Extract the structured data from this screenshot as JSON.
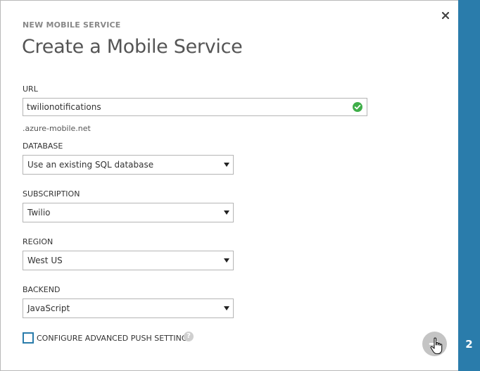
{
  "wizard": {
    "label": "NEW MOBILE SERVICE",
    "title": "Create a Mobile Service",
    "step": "2"
  },
  "url": {
    "label": "URL",
    "value": "twilionotifications",
    "suffix": ".azure-mobile.net",
    "status_icon": "check-circle-icon"
  },
  "database": {
    "label": "DATABASE",
    "selected": "Use an existing SQL database"
  },
  "subscription": {
    "label": "SUBSCRIPTION",
    "selected": "Twilio"
  },
  "region": {
    "label": "REGION",
    "selected": "West US"
  },
  "backend": {
    "label": "BACKEND",
    "selected": "JavaScript"
  },
  "advanced": {
    "label": "CONFIGURE ADVANCED PUSH SETTINGS",
    "checked": false,
    "help": "?"
  },
  "colors": {
    "accent": "#2a7cab",
    "valid": "#3fae49",
    "next_button": "#c4c4c4"
  }
}
